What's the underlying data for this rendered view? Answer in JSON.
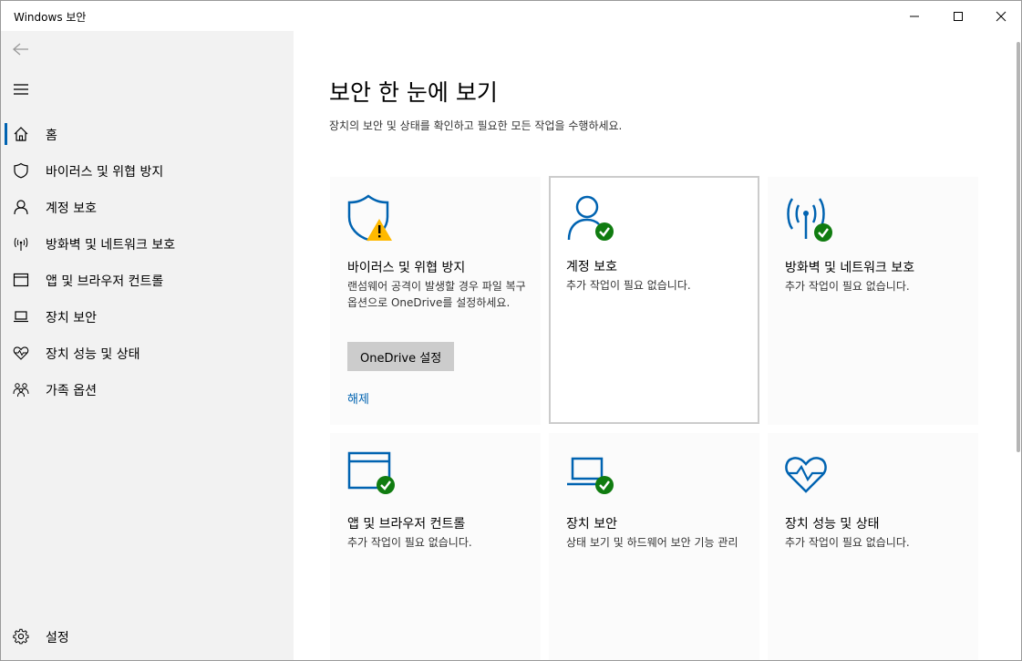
{
  "window": {
    "title": "Windows 보안"
  },
  "sidebar": {
    "items": [
      {
        "label": "홈",
        "icon": "home-icon",
        "active": true
      },
      {
        "label": "바이러스 및 위협 방지",
        "icon": "shield-icon"
      },
      {
        "label": "계정 보호",
        "icon": "person-icon"
      },
      {
        "label": "방화벽 및 네트워크 보호",
        "icon": "antenna-icon"
      },
      {
        "label": "앱 및 브라우저 컨트롤",
        "icon": "browser-window-icon"
      },
      {
        "label": "장치 보안",
        "icon": "laptop-icon"
      },
      {
        "label": "장치 성능 및 상태",
        "icon": "heart-pulse-icon"
      },
      {
        "label": "가족 옵션",
        "icon": "family-icon"
      }
    ],
    "settings_label": "설정"
  },
  "main": {
    "title": "보안 한 눈에 보기",
    "subtitle": "장치의 보안 및 상태를 확인하고 필요한 모든 작업을 수행하세요.",
    "tiles": [
      {
        "title": "바이러스 및 위협 방지",
        "desc": "랜섬웨어 공격이 발생할 경우 파일 복구 옵션으로 OneDrive를 설정하세요.",
        "button": "OneDrive 설정",
        "link": "해제",
        "status": "warning"
      },
      {
        "title": "계정 보호",
        "desc": "추가 작업이 필요 없습니다.",
        "status": "ok"
      },
      {
        "title": "방화벽 및 네트워크 보호",
        "desc": "추가 작업이 필요 없습니다.",
        "status": "ok"
      },
      {
        "title": "앱 및 브라우저 컨트롤",
        "desc": "추가 작업이 필요 없습니다.",
        "status": "ok"
      },
      {
        "title": "장치 보안",
        "desc": "상태 보기 및 하드웨어 보안 기능 관리",
        "status": "ok"
      },
      {
        "title": "장치 성능 및 상태",
        "desc": "추가 작업이 필요 없습니다.",
        "status": "none"
      }
    ]
  },
  "colors": {
    "accent": "#0063b1",
    "ok": "#107c10",
    "warning": "#ffb900",
    "sidebar_bg": "#f2f2f2"
  }
}
